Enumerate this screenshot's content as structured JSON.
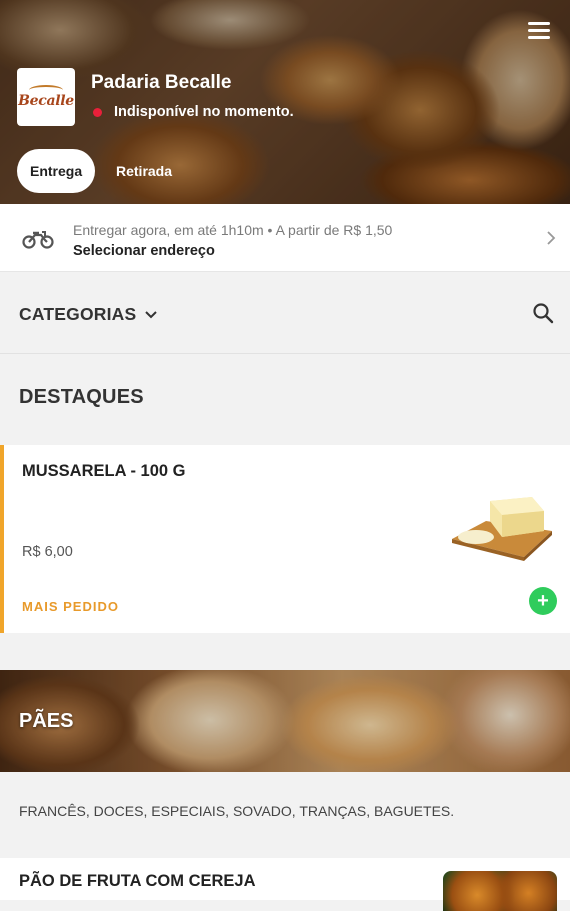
{
  "store": {
    "name": "Padaria Becalle",
    "status": "Indisponível no momento.",
    "status_color": "#e8203a",
    "logo_text": "Becalle"
  },
  "tabs": [
    {
      "label": "Entrega",
      "selected": true
    },
    {
      "label": "Retirada",
      "selected": false
    }
  ],
  "delivery": {
    "info": "Entregar agora, em até 1h10m  •  A partir de R$ 1,50",
    "action": "Selecionar endereço",
    "icon": "motorcycle-icon"
  },
  "categories": {
    "label": "CATEGORIAS"
  },
  "highlights": {
    "title": "DESTAQUES",
    "items": [
      {
        "name": "MUSSARELA - 100 G",
        "price": "R$ 6,00",
        "badge": "MAIS PEDIDO",
        "image": "cheese-on-board"
      }
    ]
  },
  "section_paes": {
    "title": "PÃES",
    "description": "FRANCÊS, DOCES, ESPECIAIS, SOVADO, TRANÇAS, BAGUETES.",
    "items": [
      {
        "name": "PÃO DE FRUTA COM CEREJA",
        "image": "fruit-bread"
      }
    ]
  },
  "colors": {
    "accent": "#f0a52a",
    "add_button": "#2fcc5c",
    "badge_text": "#e89a2b"
  }
}
